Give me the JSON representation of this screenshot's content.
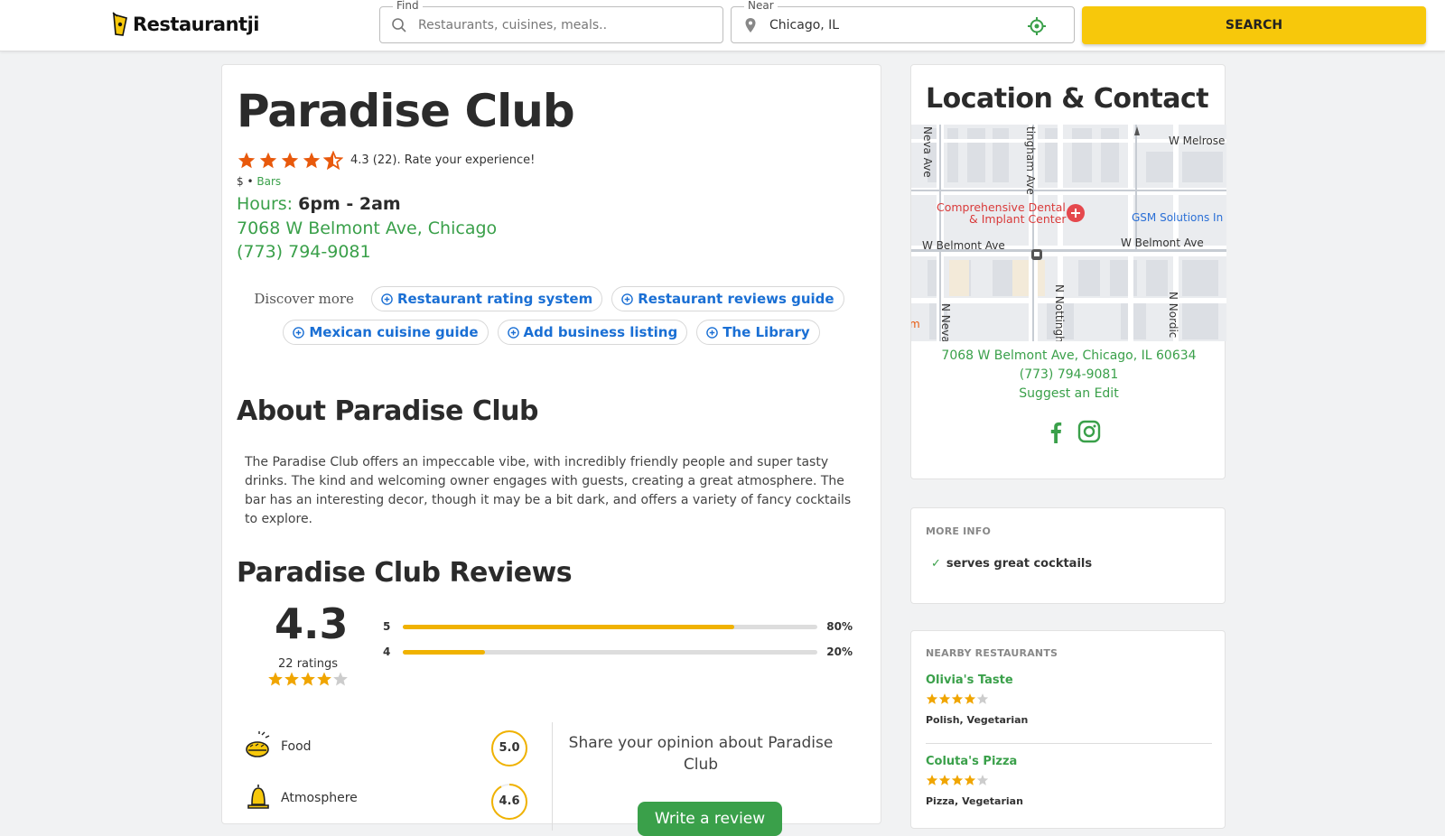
{
  "header": {
    "logo_text": "Restaurantji",
    "find_label": "Find",
    "find_placeholder": "Restaurants, cuisines, meals..",
    "near_label": "Near",
    "near_value": "Chicago, IL",
    "search_label": "SEARCH",
    "accent": "#f7c80b"
  },
  "restaurant": {
    "name": "Paradise Club",
    "rating_value": 4.3,
    "rating_text": "4.3 (22). Rate your experience!",
    "price": "$",
    "separator": "•",
    "category": "Bars",
    "hours_label": "Hours",
    "hours_value": "6pm - 2am",
    "address": "7068 W Belmont Ave, Chicago",
    "phone": "(773) 794-9081"
  },
  "discover": {
    "label": "Discover more",
    "links": [
      "Restaurant rating system",
      "Restaurant reviews guide",
      "Mexican cuisine guide",
      "Add business listing",
      "The Library"
    ]
  },
  "about": {
    "heading": "About Paradise Club",
    "text": "The Paradise Club offers an impeccable vibe, with incredibly friendly people and super tasty drinks. The kind and welcoming owner engages with guests, creating a great atmosphere. The bar has an interesting decor, though it may be a bit dark, and offers a variety of fancy cocktails to explore."
  },
  "reviews": {
    "heading": "Paradise Club Reviews",
    "overall": "4.3",
    "count_text": "22 ratings",
    "distribution": [
      {
        "stars": "5",
        "percent": 80,
        "percent_text": "80%"
      },
      {
        "stars": "4",
        "percent": 20,
        "percent_text": "20%"
      }
    ],
    "subratings": [
      {
        "label": "Food",
        "score": "5.0",
        "value": 5.0,
        "icon": "burger-icon"
      },
      {
        "label": "Atmosphere",
        "score": "4.6",
        "value": 4.6,
        "icon": "bell-icon"
      }
    ],
    "share_text": "Share your opinion about Paradise Club",
    "write_label": "Write a review"
  },
  "contact": {
    "heading": "Location & Contact",
    "address_full": "7068 W Belmont Ave, Chicago, IL 60634",
    "phone": "(773) 794-9081",
    "suggest_edit": "Suggest an Edit",
    "social": [
      "facebook-icon",
      "instagram-icon"
    ],
    "map": {
      "labels": {
        "melrose": "W Melrose",
        "dental1": "Comprehensive Dental",
        "dental2": "& Implant Center",
        "gsm": "GSM Solutions In",
        "belmont_left": "W Belmont Ave",
        "belmont_right": "W Belmont Ave",
        "neva_top": "Neva Ave",
        "nottingham_top": "tingham Ave",
        "neva_bottom": "N Neva",
        "nottingham_bottom": "N Nottingh",
        "nordica": "N Nordic",
        "edge": "m"
      }
    }
  },
  "more_info": {
    "heading": "MORE INFO",
    "items": [
      "serves great cocktails"
    ]
  },
  "nearby": {
    "heading": "NEARBY RESTAURANTS",
    "items": [
      {
        "name": "Olivia's Taste",
        "rating": 4,
        "cuisine": "Polish, Vegetarian"
      },
      {
        "name": "Coluta's Pizza",
        "rating": 4,
        "cuisine": "Pizza, Vegetarian"
      }
    ]
  },
  "colors": {
    "green": "#3aa04a",
    "link_blue": "#1a6fd4",
    "star_orange": "#e8590c",
    "star_gold": "#f0a500"
  }
}
